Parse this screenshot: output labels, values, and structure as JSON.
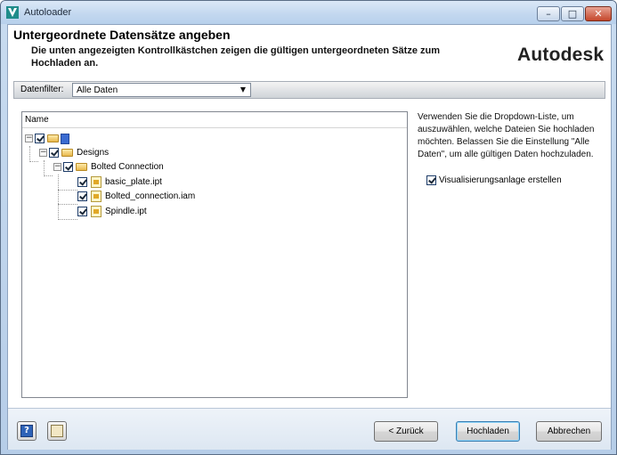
{
  "window": {
    "title": "Autoloader",
    "controls": {
      "minimize": "–",
      "maximize": "□",
      "close": "✕"
    }
  },
  "header": {
    "title": "Untergeordnete Datensätze angeben",
    "description": "Die unten angezeigten Kontrollkästchen zeigen die gültigen untergeordneten Sätze zum Hochladen an.",
    "logo": "Autodesk"
  },
  "filter": {
    "label": "Datenfilter:",
    "selected": "Alle Daten"
  },
  "tree": {
    "column_header": "Name",
    "items": [
      {
        "label": "",
        "type": "root",
        "checked": true,
        "expanded": true
      },
      {
        "label": "Designs",
        "type": "folder",
        "checked": true,
        "expanded": true
      },
      {
        "label": "Bolted Connection",
        "type": "folder",
        "checked": true,
        "expanded": true
      },
      {
        "label": "basic_plate.ipt",
        "type": "file",
        "checked": true
      },
      {
        "label": "Bolted_connection.iam",
        "type": "file",
        "checked": true
      },
      {
        "label": "Spindle.ipt",
        "type": "file",
        "checked": true
      }
    ]
  },
  "help_text": "Verwenden Sie die Dropdown-Liste, um auszuwählen, welche Dateien Sie hochladen möchten. Belassen Sie die Einstellung \"Alle Daten\", um alle gültigen Daten hochzuladen.",
  "visualization": {
    "label": "Visualisierungsanlage erstellen",
    "checked": true
  },
  "footer": {
    "help_icon_text": "?",
    "back_label": "< Zurück",
    "upload_label": "Hochladen",
    "cancel_label": "Abbrechen"
  },
  "colors": {
    "titlebar": "#c2d7ef",
    "close_button": "#c4462a",
    "default_button_border": "#3c7fb1"
  }
}
